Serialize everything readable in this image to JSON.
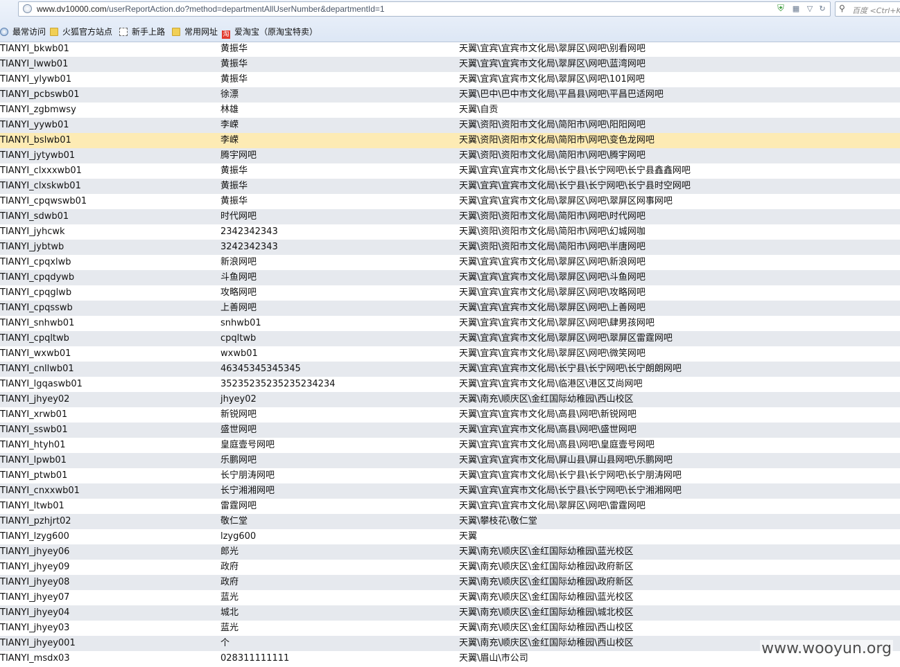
{
  "browser": {
    "url_host": "www.dv10000.com",
    "url_path": "/userReportAction.do?method=departmentAllUserNumber&departmentId=1",
    "search_placeholder": "百度 <Ctrl+K>"
  },
  "bookmarks": [
    {
      "label": "最常访问",
      "icon": "globe-icon"
    },
    {
      "label": "火狐官方站点",
      "icon": "folder-icon"
    },
    {
      "label": "新手上路",
      "icon": "dashed-page-icon"
    },
    {
      "label": "常用网址",
      "icon": "folder-icon"
    },
    {
      "label": "爱淘宝（原淘宝特卖）",
      "icon": "taobao-icon"
    }
  ],
  "rows": [
    {
      "id": "TIANYI_bkwb01",
      "name": "黄振华",
      "dept": "天翼\\宜宾\\宜宾市文化局\\翠屏区\\网吧\\别看网吧"
    },
    {
      "id": "TIANYI_lwwb01",
      "name": "黄振华",
      "dept": "天翼\\宜宾\\宜宾市文化局\\翠屏区\\网吧\\蓝湾网吧"
    },
    {
      "id": "TIANYI_ylywb01",
      "name": "黄振华",
      "dept": "天翼\\宜宾\\宜宾市文化局\\翠屏区\\网吧\\101网吧"
    },
    {
      "id": "TIANYI_pcbswb01",
      "name": "徐漂",
      "dept": "天翼\\巴中\\巴中市文化局\\平昌县\\网吧\\平昌巴适网吧"
    },
    {
      "id": "TIANYI_zgbmwsy",
      "name": "林雄",
      "dept": "天翼\\自贡"
    },
    {
      "id": "TIANYI_yywb01",
      "name": "李嵘",
      "dept": "天翼\\资阳\\资阳市文化局\\简阳市\\网吧\\阳阳网吧"
    },
    {
      "id": "TIANYI_bslwb01",
      "name": "李嵘",
      "dept": "天翼\\资阳\\资阳市文化局\\简阳市\\网吧\\变色龙网吧"
    },
    {
      "id": "TIANYI_jytywb01",
      "name": "腾宇网吧",
      "dept": "天翼\\资阳\\资阳市文化局\\简阳市\\网吧\\腾宇网吧"
    },
    {
      "id": "TIANYI_clxxxwb01",
      "name": "黄振华",
      "dept": "天翼\\宜宾\\宜宾市文化局\\长宁县\\长宁网吧\\长宁县鑫鑫网吧"
    },
    {
      "id": "TIANYI_clxskwb01",
      "name": "黄振华",
      "dept": "天翼\\宜宾\\宜宾市文化局\\长宁县\\长宁网吧\\长宁县时空网吧"
    },
    {
      "id": "TIANYI_cpqwswb01",
      "name": "黄振华",
      "dept": "天翼\\宜宾\\宜宾市文化局\\翠屏区\\网吧\\翠屏区网事网吧"
    },
    {
      "id": "TIANYI_sdwb01",
      "name": "时代网吧",
      "dept": "天翼\\资阳\\资阳市文化局\\简阳市\\网吧\\时代网吧"
    },
    {
      "id": "TIANYI_jyhcwk",
      "name": "2342342343",
      "dept": "天翼\\资阳\\资阳市文化局\\简阳市\\网吧\\幻城网咖"
    },
    {
      "id": "TIANYI_jybtwb",
      "name": "3242342343",
      "dept": "天翼\\资阳\\资阳市文化局\\简阳市\\网吧\\半唐网吧"
    },
    {
      "id": "TIANYI_cpqxlwb",
      "name": "新浪网吧",
      "dept": "天翼\\宜宾\\宜宾市文化局\\翠屏区\\网吧\\新浪网吧"
    },
    {
      "id": "TIANYI_cpqdywb",
      "name": "斗鱼网吧",
      "dept": "天翼\\宜宾\\宜宾市文化局\\翠屏区\\网吧\\斗鱼网吧"
    },
    {
      "id": "TIANYI_cpqglwb",
      "name": "攻略网吧",
      "dept": "天翼\\宜宾\\宜宾市文化局\\翠屏区\\网吧\\攻略网吧"
    },
    {
      "id": "TIANYI_cpqsswb",
      "name": "上善网吧",
      "dept": "天翼\\宜宾\\宜宾市文化局\\翠屏区\\网吧\\上善网吧"
    },
    {
      "id": "TIANYI_snhwb01",
      "name": "snhwb01",
      "dept": "天翼\\宜宾\\宜宾市文化局\\翠屏区\\网吧\\肆男孩网吧"
    },
    {
      "id": "TIANYI_cpqltwb",
      "name": "cpqltwb",
      "dept": "天翼\\宜宾\\宜宾市文化局\\翠屏区\\网吧\\翠屏区雷霆网吧"
    },
    {
      "id": "TIANYI_wxwb01",
      "name": "wxwb01",
      "dept": "天翼\\宜宾\\宜宾市文化局\\翠屏区\\网吧\\微笑网吧"
    },
    {
      "id": "TIANYI_cnllwb01",
      "name": "46345345345345",
      "dept": "天翼\\宜宾\\宜宾市文化局\\长宁县\\长宁网吧\\长宁朗朗网吧"
    },
    {
      "id": "TIANYI_lgqaswb01",
      "name": "35235235235235234234",
      "dept": "天翼\\宜宾\\宜宾市文化局\\临港区\\港区艾尚网吧"
    },
    {
      "id": "TIANYI_jhyey02",
      "name": "jhyey02",
      "dept": "天翼\\南充\\顺庆区\\金红国际幼稚园\\西山校区"
    },
    {
      "id": "TIANYI_xrwb01",
      "name": "新锐网吧",
      "dept": "天翼\\宜宾\\宜宾市文化局\\高县\\网吧\\新锐网吧"
    },
    {
      "id": "TIANYI_sswb01",
      "name": "盛世网吧",
      "dept": "天翼\\宜宾\\宜宾市文化局\\高县\\网吧\\盛世网吧"
    },
    {
      "id": "TIANYI_htyh01",
      "name": "皇庭壹号网吧",
      "dept": "天翼\\宜宾\\宜宾市文化局\\高县\\网吧\\皇庭壹号网吧"
    },
    {
      "id": "TIANYI_lpwb01",
      "name": "乐鹏网吧",
      "dept": "天翼\\宜宾\\宜宾市文化局\\屏山县\\屏山县网吧\\乐鹏网吧"
    },
    {
      "id": "TIANYI_ptwb01",
      "name": "长宁朋涛网吧",
      "dept": "天翼\\宜宾\\宜宾市文化局\\长宁县\\长宁网吧\\长宁朋涛网吧"
    },
    {
      "id": "TIANYI_cnxxwb01",
      "name": "长宁湘湘网吧",
      "dept": "天翼\\宜宾\\宜宾市文化局\\长宁县\\长宁网吧\\长宁湘湘网吧"
    },
    {
      "id": "TIANYI_ltwb01",
      "name": "雷霆网吧",
      "dept": "天翼\\宜宾\\宜宾市文化局\\翠屏区\\网吧\\雷霆网吧"
    },
    {
      "id": "TIANYI_pzhjrt02",
      "name": "敬仁堂",
      "dept": "天翼\\攀枝花\\敬仁堂"
    },
    {
      "id": "TIANYI_lzyg600",
      "name": "lzyg600",
      "dept": "天翼"
    },
    {
      "id": "TIANYI_jhyey06",
      "name": "郎光",
      "dept": "天翼\\南充\\顺庆区\\金红国际幼稚园\\蓝光校区"
    },
    {
      "id": "TIANYI_jhyey09",
      "name": "政府",
      "dept": "天翼\\南充\\顺庆区\\金红国际幼稚园\\政府新区"
    },
    {
      "id": "TIANYI_jhyey08",
      "name": "政府",
      "dept": "天翼\\南充\\顺庆区\\金红国际幼稚园\\政府新区"
    },
    {
      "id": "TIANYI_jhyey07",
      "name": "蓝光",
      "dept": "天翼\\南充\\顺庆区\\金红国际幼稚园\\蓝光校区"
    },
    {
      "id": "TIANYI_jhyey04",
      "name": "城北",
      "dept": "天翼\\南充\\顺庆区\\金红国际幼稚园\\城北校区"
    },
    {
      "id": "TIANYI_jhyey03",
      "name": "蓝光",
      "dept": "天翼\\南充\\顺庆区\\金红国际幼稚园\\西山校区"
    },
    {
      "id": "TIANYI_jhyey001",
      "name": "个",
      "dept": "天翼\\南充\\顺庆区\\金红国际幼稚园\\西山校区"
    },
    {
      "id": "TIANYI_msdx03",
      "name": "028311111111",
      "dept": "天翼\\眉山\\市公司"
    }
  ],
  "watermark": "www.wooyun.org"
}
